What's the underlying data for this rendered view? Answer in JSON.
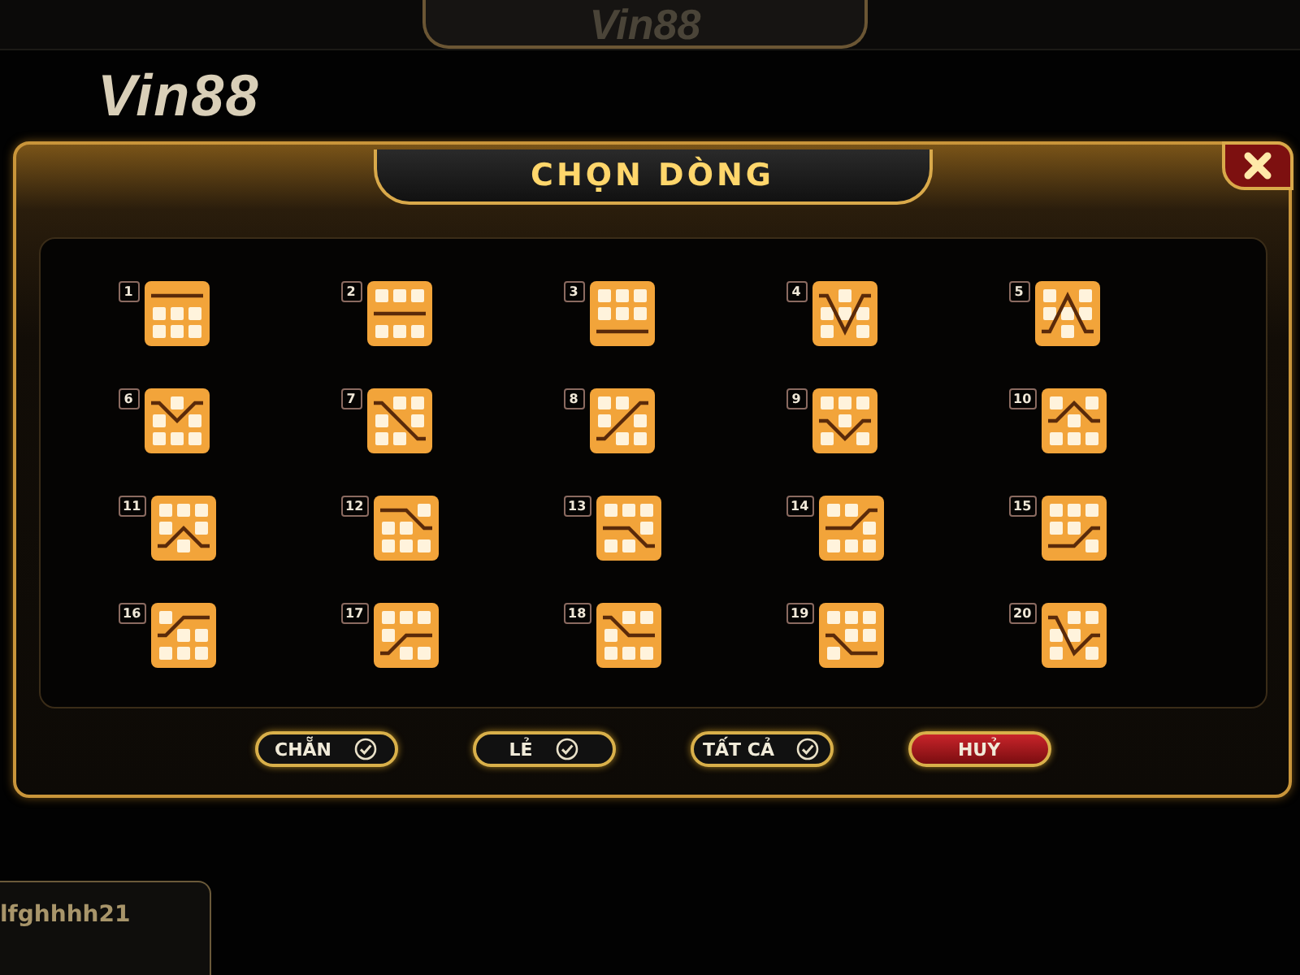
{
  "header": {
    "top_logo": "Vin88"
  },
  "logo": "Vin88",
  "dialog": {
    "title": "CHỌN DÒNG",
    "lines": [
      {
        "number": "1",
        "kind": "TTT"
      },
      {
        "number": "2",
        "kind": "MMM"
      },
      {
        "number": "3",
        "kind": "BBB"
      },
      {
        "number": "4",
        "kind": "TBT"
      },
      {
        "number": "5",
        "kind": "BTB"
      },
      {
        "number": "6",
        "kind": "TMT"
      },
      {
        "number": "7",
        "kind": "TMB"
      },
      {
        "number": "8",
        "kind": "BMT"
      },
      {
        "number": "9",
        "kind": "MBM"
      },
      {
        "number": "10",
        "kind": "MTM"
      },
      {
        "number": "11",
        "kind": "BMB"
      },
      {
        "number": "12",
        "kind": "TTM"
      },
      {
        "number": "13",
        "kind": "MMB"
      },
      {
        "number": "14",
        "kind": "MMT"
      },
      {
        "number": "15",
        "kind": "BBM"
      },
      {
        "number": "16",
        "kind": "MTT"
      },
      {
        "number": "17",
        "kind": "BMM"
      },
      {
        "number": "18",
        "kind": "TMM"
      },
      {
        "number": "19",
        "kind": "MBB"
      },
      {
        "number": "20",
        "kind": "TBM"
      }
    ],
    "buttons": [
      {
        "label": "CHẴN",
        "kind": "check"
      },
      {
        "label": "LẺ",
        "kind": "check"
      },
      {
        "label": "TẤT CẢ",
        "kind": "check"
      },
      {
        "label": "HUỶ",
        "kind": "cancel"
      }
    ]
  },
  "player_tab": {
    "username": "lfghhhh21"
  }
}
